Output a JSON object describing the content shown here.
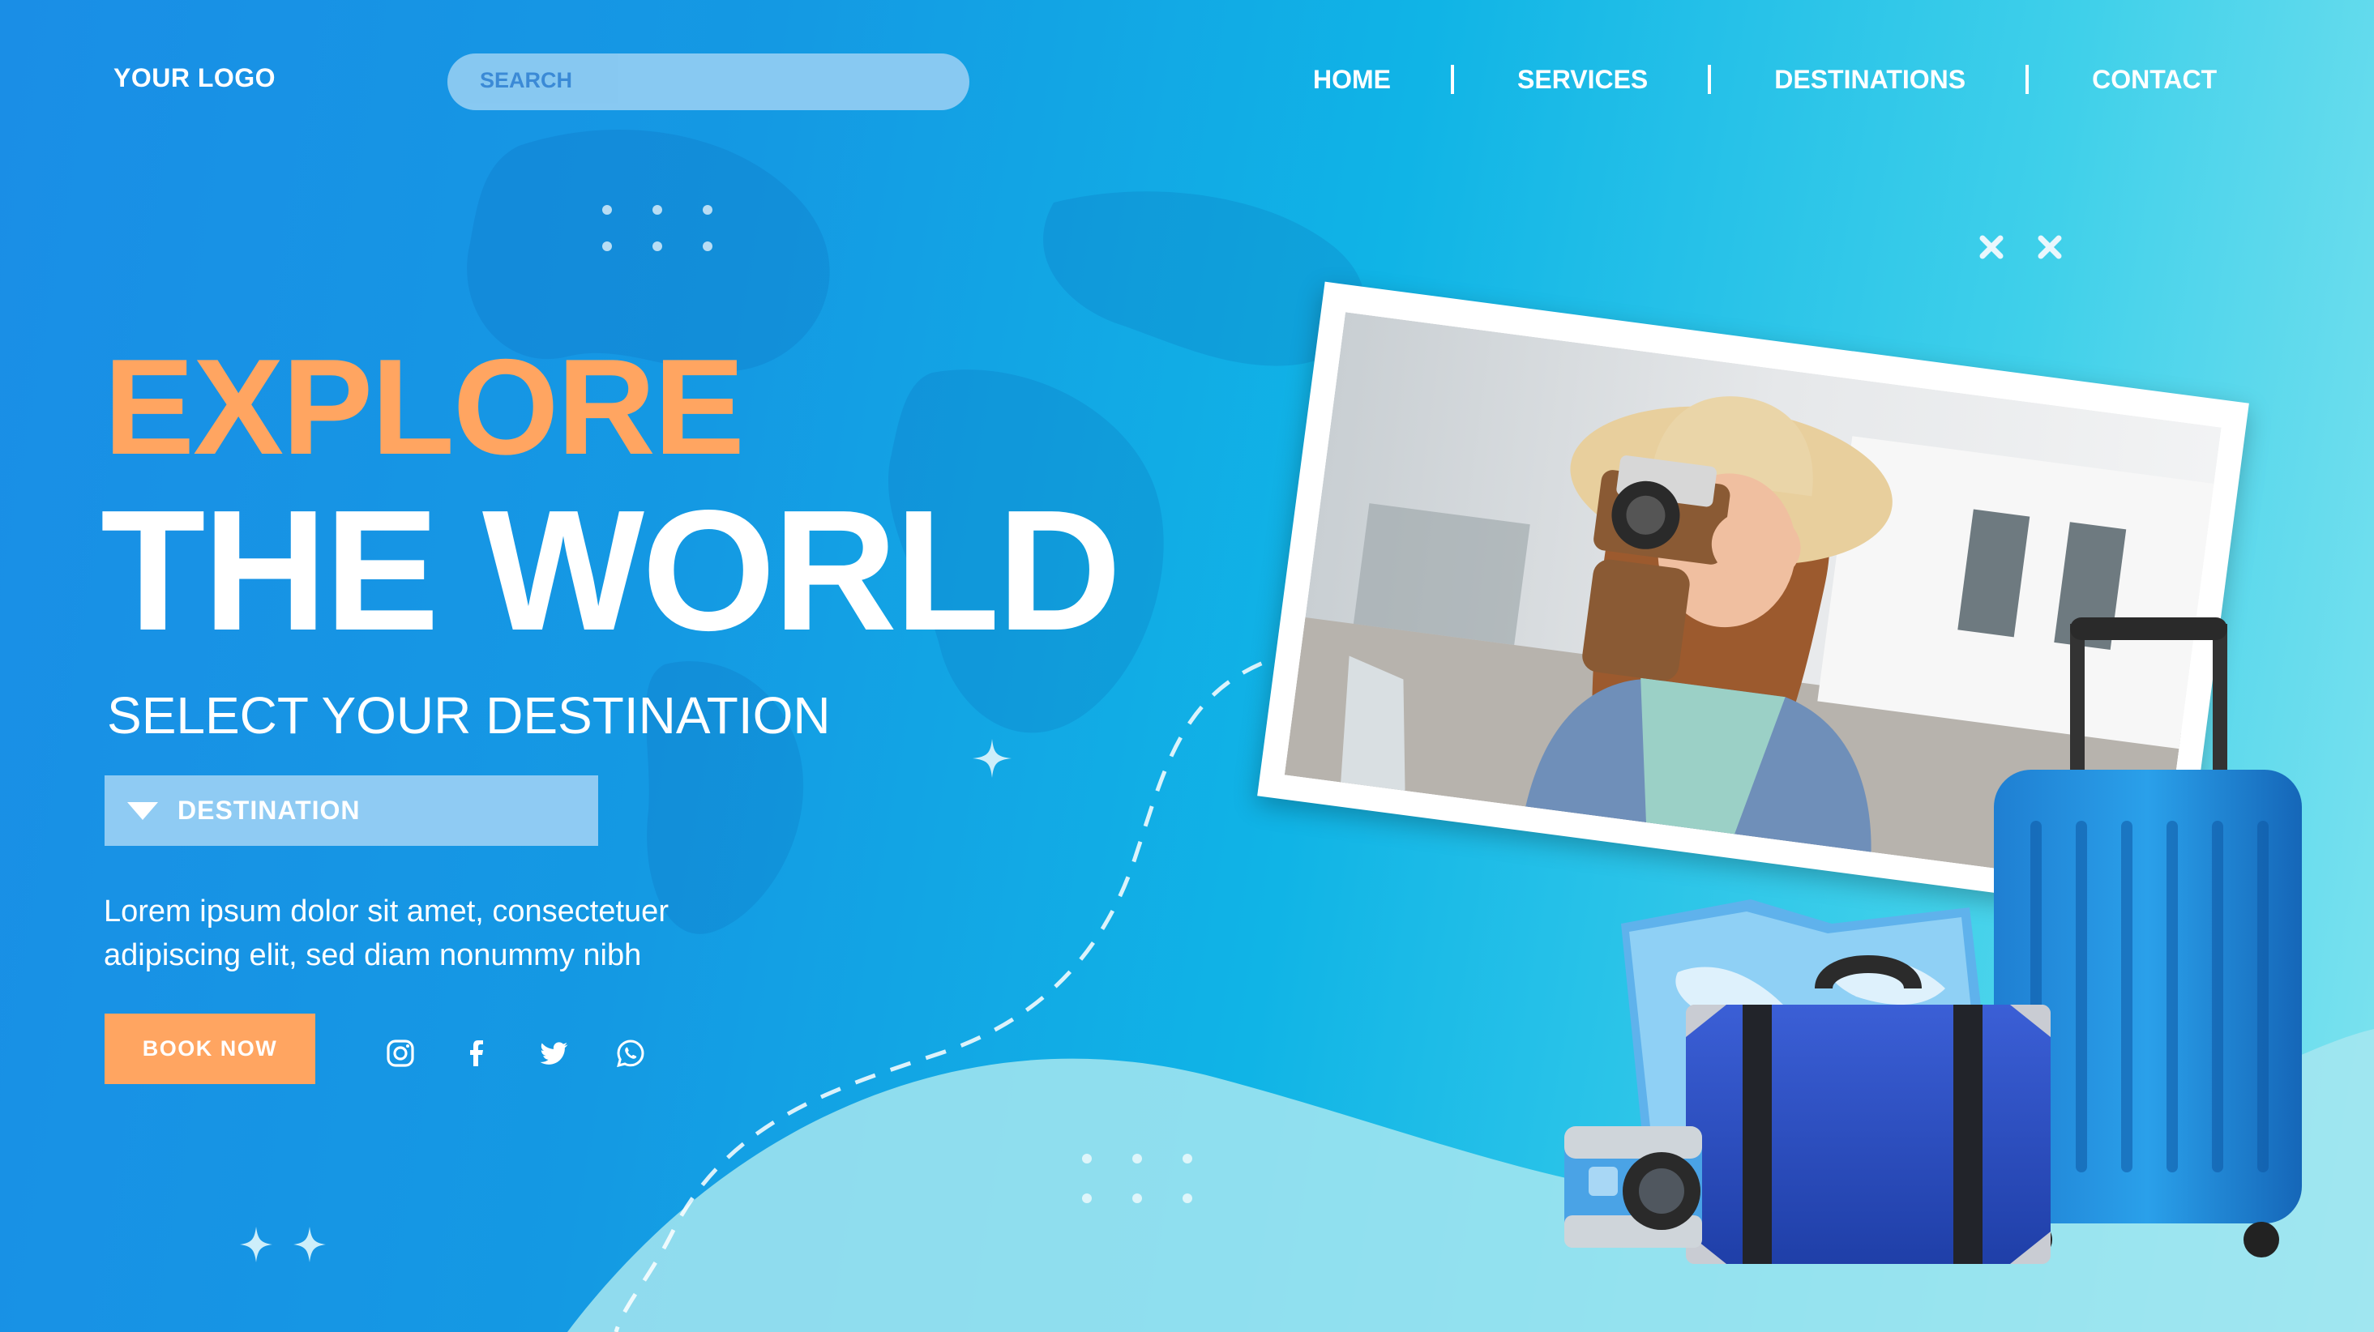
{
  "header": {
    "logo": "YOUR LOGO",
    "search_placeholder": "SEARCH",
    "nav": [
      "HOME",
      "SERVICES",
      "DESTINATIONS",
      "CONTACT"
    ]
  },
  "hero": {
    "title_line1": "EXPLORE",
    "title_line2": "THE WORLD",
    "subtitle": "SELECT YOUR DESTINATION",
    "destination_dropdown": "DESTINATION",
    "body_line1": "Lorem ipsum dolor sit amet, consectetuer",
    "body_line2": "adipiscing elit, sed diam nonummy nibh",
    "cta": "BOOK NOW"
  },
  "social": [
    "instagram-icon",
    "facebook-icon",
    "twitter-icon",
    "whatsapp-icon"
  ],
  "colors": {
    "accent": "#ffa561",
    "background_start": "#1a8ee6",
    "background_end": "#7fe3ef",
    "search_bg": "#8ecbf2"
  }
}
